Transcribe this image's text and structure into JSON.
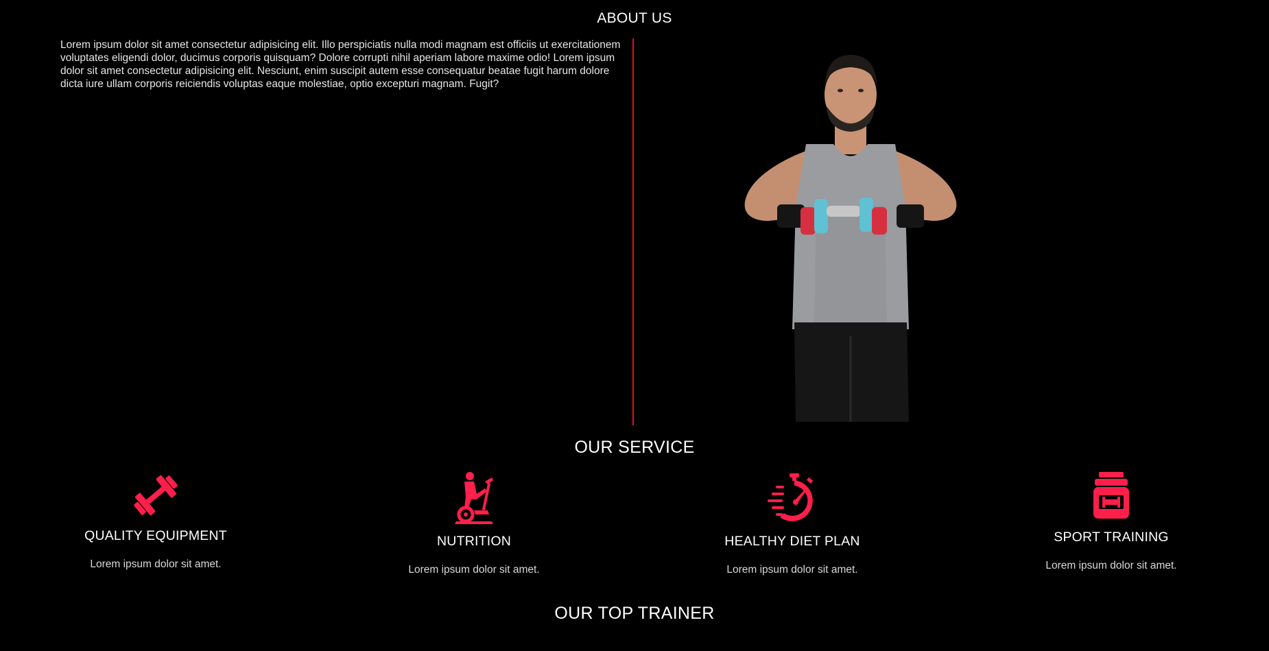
{
  "about": {
    "title": "ABOUT US",
    "text": "Lorem ipsum dolor sit amet consectetur adipisicing elit. Illo perspiciatis nulla modi magnam est officiis ut exercitationem voluptates eligendi dolor, ducimus corporis quisquam? Dolore corrupti nihil aperiam labore maxime odio! Lorem ipsum dolor sit amet consectetur adipisicing elit. Nesciunt, enim suscipit autem esse consequatur beatae fugit harum dolore dicta iure ullam corporis reiciendis voluptas eaque molestiae, optio excepturi magnam. Fugit?"
  },
  "services": {
    "title": "OUR SERVICE",
    "items": [
      {
        "icon": "dumbbell-icon",
        "name": "QUALITY EQUIPMENT",
        "desc": "Lorem ipsum dolor sit amet."
      },
      {
        "icon": "exercise-bike-icon",
        "name": "NUTRITION",
        "desc": "Lorem ipsum dolor sit amet."
      },
      {
        "icon": "stopwatch-icon",
        "name": "HEALTHY DIET PLAN",
        "desc": "Lorem ipsum dolor sit amet."
      },
      {
        "icon": "supplement-jar-icon",
        "name": "SPORT TRAINING",
        "desc": "Lorem ipsum dolor sit amet."
      }
    ]
  },
  "trainers": {
    "title": "OUR TOP TRAINER"
  },
  "colors": {
    "background": "#000000",
    "accent": "#ff1f4b",
    "divider": "#e01020",
    "text": "#ffffff"
  }
}
